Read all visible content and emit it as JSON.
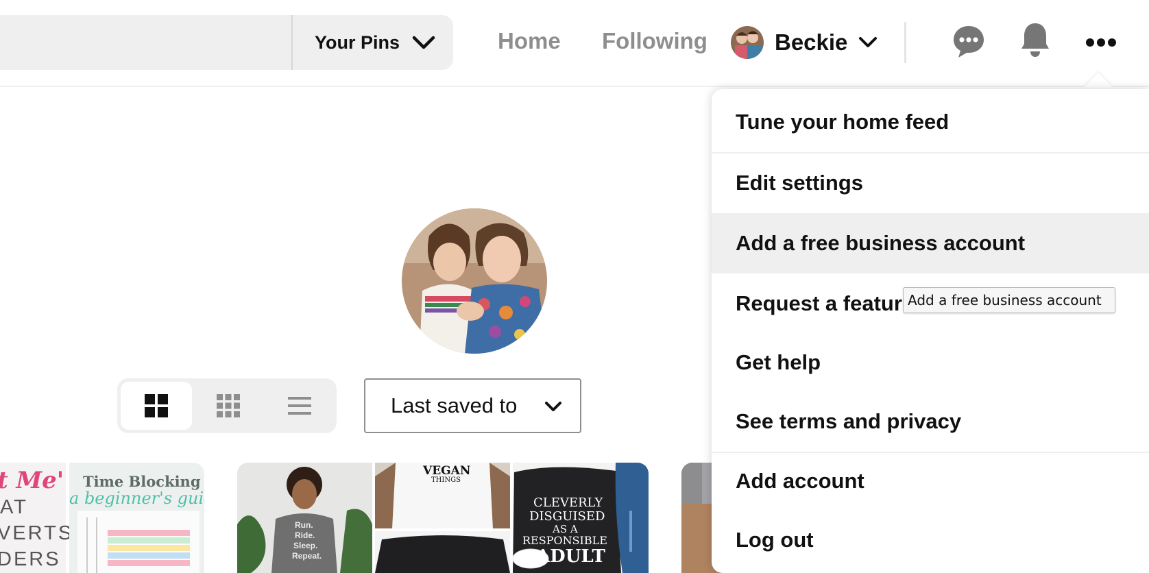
{
  "header": {
    "scope_label": "Your Pins",
    "nav": {
      "home": "Home",
      "following": "Following"
    },
    "user_name": "Beckie",
    "icons": {
      "scope": "chevron-down-icon",
      "profile": "chevron-down-icon",
      "messages": "speech-bubble-icon",
      "notifications": "bell-icon",
      "more": "ellipsis-icon"
    }
  },
  "profile": {
    "view_options": [
      {
        "name": "default-grid",
        "icon": "large-grid-icon",
        "selected": true
      },
      {
        "name": "compact-grid",
        "icon": "small-grid-icon",
        "selected": false
      },
      {
        "name": "list",
        "icon": "list-icon",
        "selected": false
      }
    ],
    "sort": {
      "label": "Last saved to",
      "icon": "chevron-down-icon"
    }
  },
  "boards": {
    "board1": {
      "left_lines": [
        "t Me'",
        "AT",
        "VERTS",
        "DERS"
      ],
      "right_title": "Time Blocking",
      "right_subtitle": "a beginner's guide"
    },
    "board2": {
      "main_shirt_lines": [
        "Run.",
        "Ride.",
        "Sleep.",
        "Repeat."
      ],
      "top_right_shirt": "VEGAN",
      "top_right_shirt_sub": "THINGS",
      "right_shirt_lines": [
        "CLEVERLY",
        "DISGUISED",
        "AS A",
        "RESPONSIBLE",
        "ADULT"
      ]
    }
  },
  "menu": {
    "items": [
      "Tune your home feed",
      "Edit settings",
      "Add a free business account",
      "Request a featur",
      "Get help",
      "See terms and privacy",
      "Add account",
      "Log out"
    ],
    "active_index": 2,
    "tooltip": "Add a free business account"
  },
  "colors": {
    "background": "#ffffff",
    "text": "#111111",
    "muted_text": "#8e8e8e",
    "surface": "#efefef"
  }
}
